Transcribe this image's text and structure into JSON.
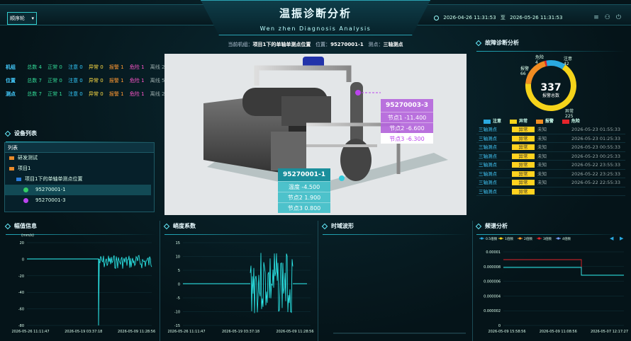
{
  "header": {
    "title": "温振诊断分析",
    "subtitle": "Wen zhen Diagnosis Analysis",
    "order_select": "顺序轮",
    "date_start": "2026-04-26 11:31:53",
    "date_sep": "至",
    "date_end": "2026-05-26 11:31:53"
  },
  "info": {
    "current_label": "当前机组：",
    "current_value": "项目1下的单轴单测点位置",
    "pos_label": "位置：",
    "pos_value": "95270001-1",
    "point_label": "测点：",
    "point_value": "三轴测点"
  },
  "stats": [
    {
      "label": "机组",
      "items": [
        "总数 4",
        "正常 0",
        "注意 0",
        "异常 0",
        "报警 1",
        "危险 1",
        "离线 2"
      ]
    },
    {
      "label": "位置",
      "items": [
        "总数 7",
        "正常 0",
        "注意 0",
        "异常 0",
        "报警 1",
        "危险 1",
        "离线 5"
      ]
    },
    {
      "label": "测点",
      "items": [
        "总数 7",
        "正常 1",
        "注意 0",
        "异常 0",
        "报警 1",
        "危险 1",
        "离线 2"
      ]
    }
  ],
  "device_list": {
    "heading": "设备列表",
    "header": "列表",
    "items": [
      "研发测试",
      "项目1",
      "项目1下的单轴单测点位置",
      "95270001-1",
      "95270001-3"
    ]
  },
  "tooltips": {
    "t1": {
      "title": "95270003-3",
      "rows": [
        "节点1 -11.400",
        "节点2 -6.600",
        "节点3 -6.300"
      ]
    },
    "t2": {
      "title": "95270001-1",
      "rows": [
        "温度 -4.500",
        "节点2 1.900",
        "节点3 0.800"
      ]
    }
  },
  "fault": {
    "heading": "故障诊断分析",
    "total": "337",
    "total_label": "报警总数",
    "ring_labels": {
      "top_left": "危险",
      "top_left_v": "4",
      "left": "报警",
      "left_v": "66",
      "top_right": "注意",
      "top_right_v": "42",
      "bottom": "异常",
      "bottom_v": "225"
    },
    "legend": [
      "注意",
      "异常",
      "报警",
      "危险"
    ],
    "colors": {
      "attention": "#2aa9e0",
      "abnormal": "#f5d31a",
      "alarm": "#f08c22",
      "danger": "#e5242b"
    },
    "rows": [
      {
        "point": "三轴测点",
        "status": "异常",
        "state": "未知",
        "time": "2026-05-23 01:55:33"
      },
      {
        "point": "三轴测点",
        "status": "异常",
        "state": "未知",
        "time": "2026-05-23 01:25:33"
      },
      {
        "point": "三轴测点",
        "status": "异常",
        "state": "未知",
        "time": "2026-05-23 00:55:33"
      },
      {
        "point": "三轴测点",
        "status": "异常",
        "state": "未知",
        "time": "2026-05-23 00:25:33"
      },
      {
        "point": "三轴测点",
        "status": "异常",
        "state": "未知",
        "time": "2026-05-22 23:55:33"
      },
      {
        "point": "三轴测点",
        "status": "异常",
        "state": "未知",
        "time": "2026-05-22 23:25:33"
      },
      {
        "point": "三轴测点",
        "status": "异常",
        "state": "未知",
        "time": "2026-05-22 22:55:33"
      },
      {
        "point": "三轴测点",
        "status": "异常",
        "state": "",
        "time": ""
      }
    ]
  },
  "panels": {
    "amp": "幅值信息",
    "peak": "峭度系数",
    "wave": "时域波形",
    "spec": "频谱分析"
  },
  "chart_data": [
    {
      "type": "line",
      "title": "幅值信息",
      "ylim": [
        -80,
        20
      ],
      "yticks": [
        "20",
        "0",
        "-20",
        "-40",
        "-60",
        "-80"
      ],
      "ylabel": "(mm/s)",
      "xticks": [
        "2026-05-26 11:11:47",
        "2026-05-19 03:37:18",
        "2026-05-09 11:28:56"
      ]
    },
    {
      "type": "line",
      "title": "峭度系数",
      "ylim": [
        -15,
        15
      ],
      "yticks": [
        "15",
        "10",
        "5",
        "0",
        "-5",
        "-10",
        "-15"
      ],
      "xticks": [
        "2026-05-26 11:11:47",
        "2026-05-19 03:37:18",
        "2026-05-09 11:28:56"
      ]
    },
    {
      "type": "line",
      "title": "频谱分析",
      "yticks": [
        "0.00001",
        "0.000008",
        "0.000006",
        "0.000004",
        "0.000002",
        "0"
      ],
      "xticks": [
        "2026-05-09 15:58:56",
        "2026-05-09 11:08:56",
        "2026-05-07 12:17:27"
      ],
      "series": [
        {
          "name": "0.5倍频"
        },
        {
          "name": "1倍频"
        },
        {
          "name": "2倍频"
        },
        {
          "name": "3倍频"
        },
        {
          "name": "4倍频"
        }
      ]
    }
  ]
}
